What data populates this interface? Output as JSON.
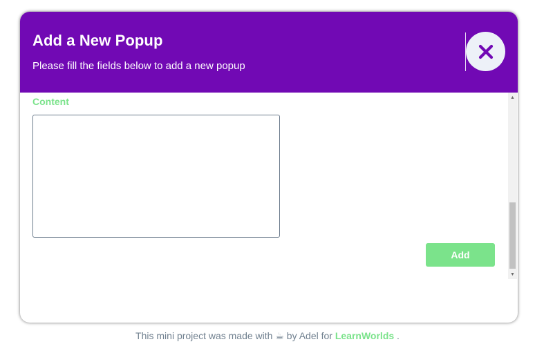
{
  "popup": {
    "title": "Add a New Popup",
    "subtitle": "Please fill the fields below to add a new popup",
    "close_icon": "close-x-icon",
    "content_label": "Content",
    "content_value": "",
    "add_label": "Add"
  },
  "footer": {
    "text_before": "This mini project was made with",
    "coffee_glyph": "☕",
    "text_middle": "by Adel for",
    "brand": "LearnWorlds",
    "text_after": "."
  },
  "colors": {
    "header_purple": "#7109b4",
    "accent_green": "#7be38b",
    "close_bg": "#edf1f8",
    "footer_text": "#70808f"
  }
}
